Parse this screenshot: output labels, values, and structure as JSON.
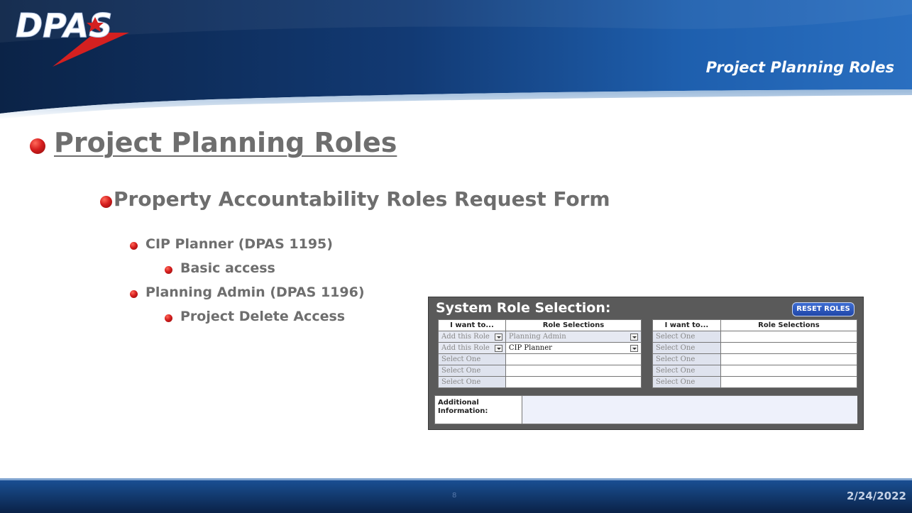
{
  "header": {
    "logo_text": "DPAS",
    "section_title": "Project Planning Roles"
  },
  "content": {
    "heading": "Project Planning Roles",
    "subheading": "Property Accountability Roles Request Form",
    "items": [
      {
        "label": "CIP Planner (DPAS 1195)",
        "sub": "Basic access"
      },
      {
        "label": "Planning Admin (DPAS 1196)",
        "sub": "Project Delete Access"
      }
    ]
  },
  "form": {
    "title": "System Role Selection:",
    "reset_label": "RESET ROLES",
    "left_headers": {
      "want": "I want to...",
      "roles": "Role Selections"
    },
    "right_headers": {
      "want": "I want to...",
      "roles": "Role Selections"
    },
    "left_rows": [
      {
        "want": "Add this Role",
        "role": "Planning Admin"
      },
      {
        "want": "Add this Role",
        "role": "CIP Planner"
      },
      {
        "want": "Select One",
        "role": ""
      },
      {
        "want": "Select One",
        "role": ""
      },
      {
        "want": "Select One",
        "role": ""
      }
    ],
    "right_rows": [
      {
        "want": "Select One",
        "role": ""
      },
      {
        "want": "Select One",
        "role": ""
      },
      {
        "want": "Select One",
        "role": ""
      },
      {
        "want": "Select One",
        "role": ""
      },
      {
        "want": "Select One",
        "role": ""
      }
    ],
    "additional_label": "Additional Information:",
    "additional_value": ""
  },
  "footer": {
    "page_number": "8",
    "date": "2/24/2022"
  },
  "colors": {
    "banner_dark": "#0c2a52",
    "banner_mid": "#1d5aa4",
    "bullet_red": "#d61e1e",
    "text_gray": "#6b6b6b"
  }
}
